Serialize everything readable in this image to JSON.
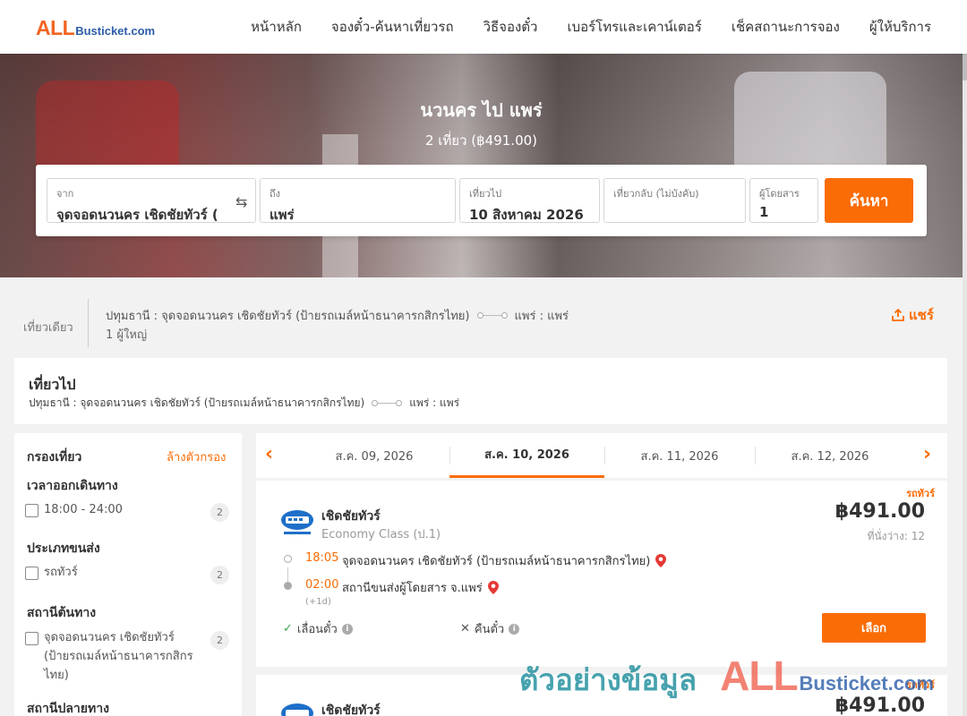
{
  "header": {
    "logo": {
      "all": "ALL",
      "rest": "Busticket.com"
    },
    "nav": [
      "หน้าหลัก",
      "จองตั๋ว-ค้นหาเที่ยวรถ",
      "วิธีจองตั๋ว",
      "เบอร์โทรและเคาน์เตอร์",
      "เช็คสถานะการจอง",
      "ผู้ให้บริการ"
    ]
  },
  "hero": {
    "title": "นวนคร ไป แพร่",
    "subtitle": "2 เที่ยว (฿491.00)"
  },
  "search": {
    "from_label": "จาก",
    "from_value": "จุดจอดนวนคร เชิดชัยทัวร์ (",
    "to_label": "ถึง",
    "to_value": "แพร่",
    "depart_label": "เที่ยวไป",
    "depart_value": "10 สิงหาคม 2026",
    "return_label": "เที่ยวกลับ (ไม่บังคับ)",
    "return_value": "",
    "pax_label": "ผู้โดยสาร",
    "pax_value": "1",
    "button": "ค้นหา"
  },
  "summary": {
    "trip_type": "เที่ยวเดียว",
    "origin": "ปทุมธานี : จุดจอดนวนคร เชิดชัยทัวร์ (ป้ายรถเมล์หน้าธนาคารกสิกรไทย)",
    "destination": "แพร่ : แพร่",
    "pax": "1 ผู้ใหญ่",
    "share": "แชร์"
  },
  "outbound": {
    "title": "เที่ยวไป",
    "origin": "ปทุมธานี : จุดจอดนวนคร เชิดชัยทัวร์ (ป้ายรถเมล์หน้าธนาคารกสิกรไทย)",
    "destination": "แพร่ : แพร่"
  },
  "filter": {
    "title": "กรองเที่ยว",
    "clear": "ล้างตัวกรอง",
    "sections": [
      {
        "title": "เวลาออกเดินทาง",
        "option": "18:00 - 24:00",
        "count": "2"
      },
      {
        "title": "ประเภทขนส่ง",
        "option": "รถทัวร์",
        "count": "2"
      },
      {
        "title": "สถานีต้นทาง",
        "option": "จุดจอดนวนคร เชิดชัยทัวร์ (ป้ายรถเมล์หน้าธนาคารกสิกรไทย)",
        "count": "2"
      },
      {
        "title": "สถานีปลายทาง"
      }
    ]
  },
  "dates": [
    "ส.ค. 09, 2026",
    "ส.ค. 10, 2026",
    "ส.ค. 11, 2026",
    "ส.ค. 12, 2026"
  ],
  "trips": [
    {
      "tag": "รถทัวร์",
      "operator": "เชิดชัยทัวร์",
      "class": "Economy Class (ป.1)",
      "price": "฿491.00",
      "seats": "ที่นั่งว่าง: 12",
      "depart_time": "18:05",
      "depart_stop": "จุดจอดนวนคร เชิดชัยทัวร์ (ป้ายรถเมล์หน้าธนาคารกสิกรไทย)",
      "arrive_time": "02:00",
      "arrive_stop": "สถานีขนส่งผู้โดยสาร จ.แพร่",
      "next_day": "(+1d)",
      "reschedule": "เลื่อนตั๋ว",
      "refund": "คืนตั๋ว",
      "select": "เลือก"
    },
    {
      "tag": "รถทัวร์",
      "operator": "เชิดชัยทัวร์",
      "price": "฿491.00"
    }
  ],
  "watermark": {
    "text": "ตัวอย่างข้อมูล",
    "all": "ALL",
    "rest": "Busticket.com"
  },
  "colors": {
    "accent": "#fa6c06",
    "brand_blue": "#2c5ca8",
    "pin_red": "#e53935"
  }
}
